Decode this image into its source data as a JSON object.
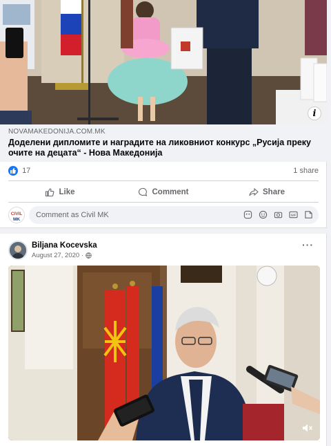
{
  "post1": {
    "link": {
      "domain": "NOVAMAKEDONIJA.COM.MK",
      "title": "Доделени дипломите и наградите на ликовниот конкурс „Русија преку очите на децата“ - Нова Македонија"
    },
    "info_badge": "i",
    "reactions": {
      "count": "17",
      "shares": "1 share"
    },
    "actions": {
      "like": "Like",
      "comment": "Comment",
      "share": "Share"
    },
    "comment_placeholder": "Comment as Civil MK",
    "commenter_avatar_text": "CIVIL MK"
  },
  "post2": {
    "author": "Biljana Kocevska",
    "date": "August 27, 2020 ·",
    "more": "···"
  },
  "colors": {
    "brand_blue": "#1877f2",
    "secondary_text": "#65676b"
  }
}
